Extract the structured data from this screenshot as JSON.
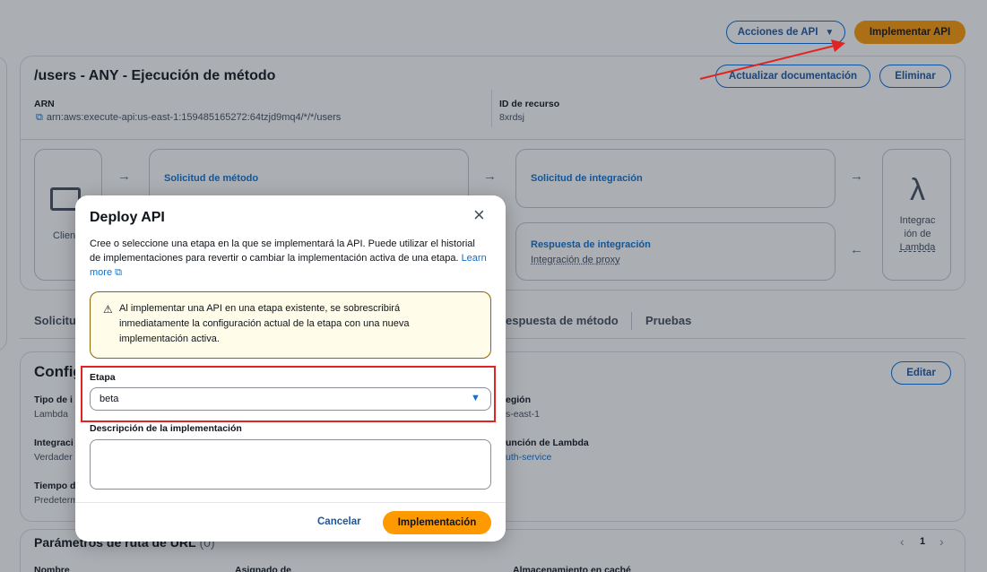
{
  "header": {
    "api_actions_label": "Acciones de API",
    "deploy_api_label": "Implementar API"
  },
  "method": {
    "title": "/users - ANY - Ejecución de método",
    "update_docs_label": "Actualizar documentación",
    "delete_label": "Eliminar",
    "arn_label": "ARN",
    "arn_value": "arn:aws:execute-api:us-east-1:159485165272:64tzjd9mq4/*/*/users",
    "resource_id_label": "ID de recurso",
    "resource_id_value": "8xrdsj"
  },
  "flow": {
    "client": "Clien",
    "method_request": "Solicitud de método",
    "integration_request": "Solicitud de integración",
    "integration_response": "Respuesta de integración",
    "proxy_integration": "Integración de proxy",
    "lambda_line1": "Integrac",
    "lambda_line2": "ión de",
    "lambda_line3": "Lambda"
  },
  "tabs": {
    "t1": "Solicitu",
    "t2": "espuesta de método",
    "t3": "Pruebas"
  },
  "config": {
    "title": "Config",
    "edit_label": "Editar",
    "type_label": "Tipo de i",
    "type_value": "Lambda",
    "region_label": "egión",
    "region_value": "s-east-1",
    "integration_label": "Integraci",
    "integration_value": "Verdader",
    "function_label": "unción de Lambda",
    "function_value": "uth-service",
    "timeout_label": "Tiempo d",
    "timeout_value": "Predeterm"
  },
  "params": {
    "title": "Parámetros de ruta de URL",
    "count": "(0)",
    "page": "1",
    "col1": "Nombre",
    "col2": "Asignado de",
    "col3": "Almacenamiento en caché"
  },
  "modal": {
    "title": "Deploy API",
    "description": "Cree o seleccione una etapa en la que se implementará la API. Puede utilizar el historial de implementaciones para revertir o cambiar la implementación activa de una etapa.",
    "learn_more": "Learn more",
    "warning": "Al implementar una API en una etapa existente, se sobrescribirá inmediatamente la configuración actual de la etapa con una nueva implementación activa.",
    "stage_label": "Etapa",
    "stage_value": "beta",
    "desc_label": "Descripción de la implementación",
    "desc_value": "",
    "cancel_label": "Cancelar",
    "deploy_label": "Implementación"
  },
  "colors": {
    "accent": "#ff9900",
    "link": "#0972d3",
    "highlight": "#e02424",
    "warning_bg": "#fffce9",
    "warning_border": "#8d6605"
  }
}
